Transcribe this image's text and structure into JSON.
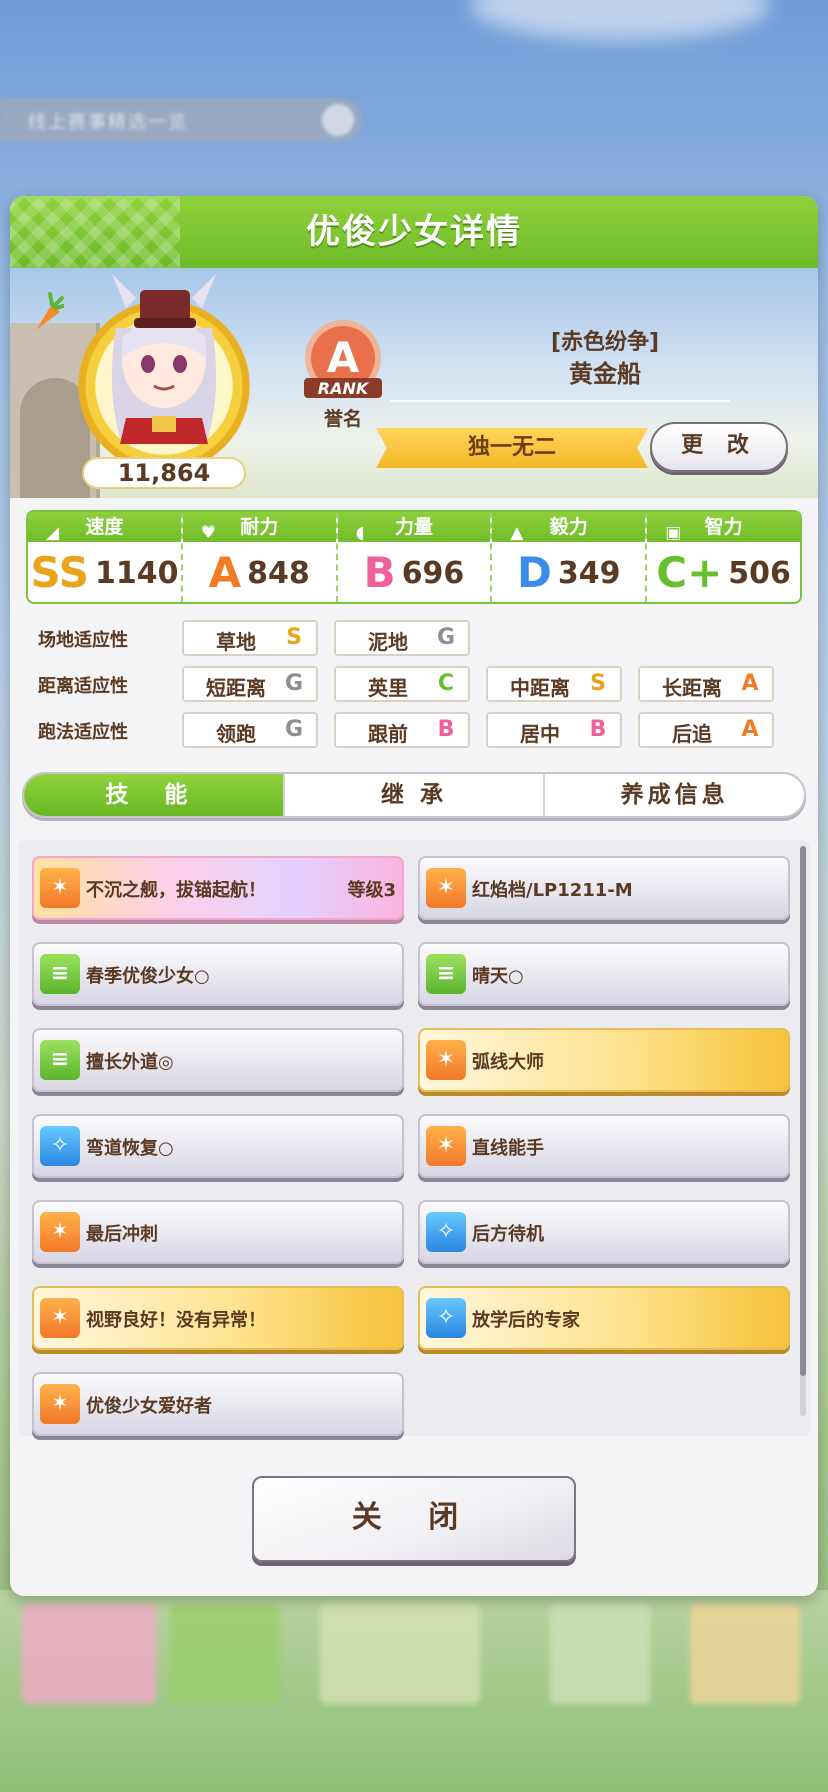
{
  "background": {
    "banner_text": "线上赛事精选一览"
  },
  "dialog": {
    "title": "优俊少女详情"
  },
  "profile": {
    "fans": "11,864",
    "rank": {
      "grade": "A",
      "badge_text": "RANK",
      "label": "誉名"
    },
    "epithet": "[赤色纷争]",
    "name": "黄金船",
    "title": "独一无二",
    "change_label": "更 改"
  },
  "stats": [
    {
      "label": "速度",
      "grade": "SS",
      "value": "1140",
      "icon": "shoe-icon",
      "color": "#e9a418"
    },
    {
      "label": "耐力",
      "grade": "A",
      "value": "848",
      "icon": "heart-icon",
      "color": "#f27b24"
    },
    {
      "label": "力量",
      "grade": "B",
      "value": "696",
      "icon": "arm-icon",
      "color": "#f0609a"
    },
    {
      "label": "毅力",
      "grade": "D",
      "value": "349",
      "icon": "flame-icon",
      "color": "#3b8ce8"
    },
    {
      "label": "智力",
      "grade": "C+",
      "value": "506",
      "icon": "cap-icon",
      "color": "#64c12c"
    }
  ],
  "aptitudes": [
    {
      "label": "场地适应性",
      "items": [
        {
          "name": "草地",
          "grade": "S"
        },
        {
          "name": "泥地",
          "grade": "G"
        }
      ]
    },
    {
      "label": "距离适应性",
      "items": [
        {
          "name": "短距离",
          "grade": "G"
        },
        {
          "name": "英里",
          "grade": "C"
        },
        {
          "name": "中距离",
          "grade": "S"
        },
        {
          "name": "长距离",
          "grade": "A"
        }
      ]
    },
    {
      "label": "跑法适应性",
      "items": [
        {
          "name": "领跑",
          "grade": "G"
        },
        {
          "name": "跟前",
          "grade": "B"
        },
        {
          "name": "居中",
          "grade": "B"
        },
        {
          "name": "后追",
          "grade": "A"
        }
      ]
    }
  ],
  "grade_colors": {
    "S": "#e9a418",
    "A": "#f27b24",
    "B": "#f0609a",
    "C": "#64c12c",
    "G": "#8e8e8e"
  },
  "tabs": [
    "技 能",
    "继 承",
    "养成信息"
  ],
  "skills": [
    {
      "name": "不沉之舰，拔锚起航！",
      "level": "等级3",
      "style": "rainbow",
      "icon": "orange"
    },
    {
      "name": "红焰档/LP1211-M",
      "level": "",
      "style": "plain",
      "icon": "orange"
    },
    {
      "name": "春季优俊少女○",
      "level": "",
      "style": "plain",
      "icon": "green"
    },
    {
      "name": "晴天○",
      "level": "",
      "style": "plain",
      "icon": "green"
    },
    {
      "name": "擅长外道◎",
      "level": "",
      "style": "plain",
      "icon": "green"
    },
    {
      "name": "弧线大师",
      "level": "",
      "style": "gold",
      "icon": "orange"
    },
    {
      "name": "弯道恢复○",
      "level": "",
      "style": "plain",
      "icon": "blue"
    },
    {
      "name": "直线能手",
      "level": "",
      "style": "plain",
      "icon": "orange"
    },
    {
      "name": "最后冲刺",
      "level": "",
      "style": "plain",
      "icon": "orange"
    },
    {
      "name": "后方待机",
      "level": "",
      "style": "plain",
      "icon": "blue"
    },
    {
      "name": "视野良好！没有异常！",
      "level": "",
      "style": "gold",
      "icon": "orange"
    },
    {
      "name": "放学后的专家",
      "level": "",
      "style": "gold",
      "icon": "blue"
    },
    {
      "name": "优俊少女爱好者",
      "level": "",
      "style": "plain",
      "icon": "orange"
    }
  ],
  "close_label": "关 闭"
}
